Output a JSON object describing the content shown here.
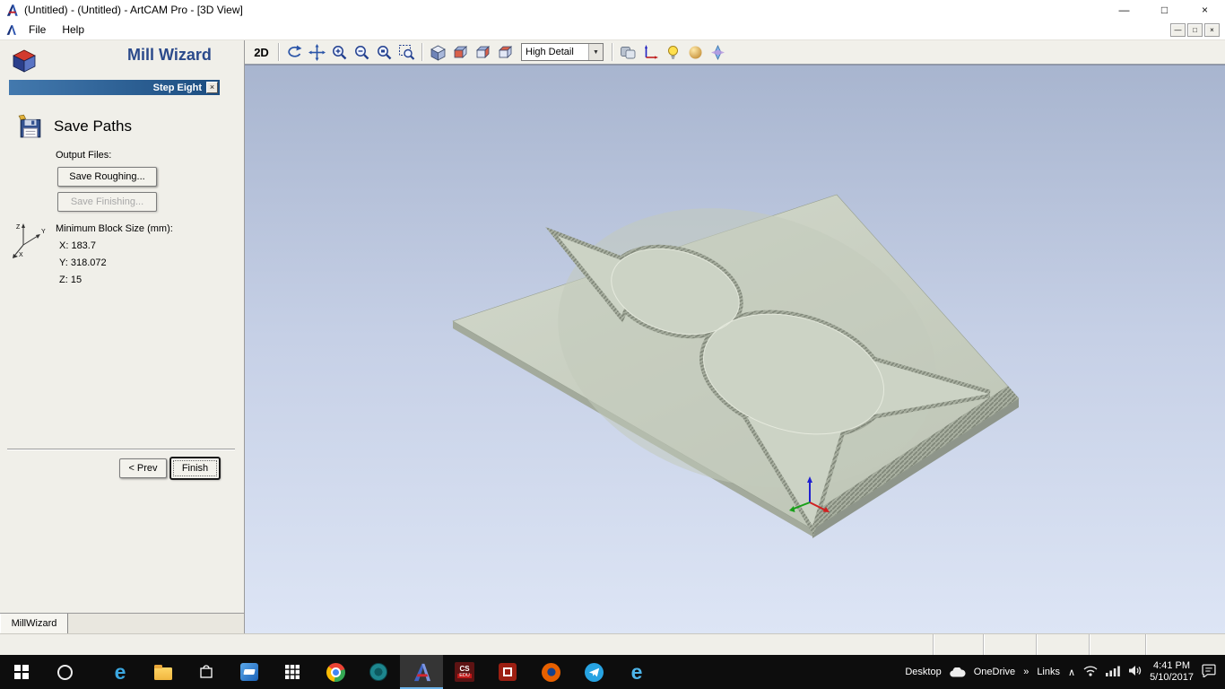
{
  "titlebar": {
    "title": "(Untitled) - (Untitled) - ArtCAM Pro - [3D View]",
    "minimize_glyph": "—",
    "maximize_glyph": "□",
    "close_glyph": "×"
  },
  "menubar": {
    "items": [
      {
        "label": "File"
      },
      {
        "label": "Help"
      }
    ],
    "mdi_minimize_glyph": "—",
    "mdi_restore_glyph": "□",
    "mdi_close_glyph": "×"
  },
  "toolbar": {
    "mode_2d_label": "2D",
    "detail_dropdown_value": "High Detail",
    "dropdown_arrow_glyph": "▼"
  },
  "wizard": {
    "title": "Mill Wizard",
    "step_label": "Step Eight",
    "close_glyph": "×",
    "heading": "Save Paths",
    "output_files_label": "Output Files:",
    "buttons": {
      "save_roughing": "Save Roughing...",
      "save_finishing": "Save Finishing...",
      "prev": "< Prev",
      "finish": "Finish"
    },
    "block_size": {
      "label": "Minimum Block Size (mm):",
      "x": "X: 183.7",
      "y": "Y: 318.072",
      "z": "Z: 15"
    },
    "axes": {
      "x": "X",
      "y": "Y",
      "z": "Z"
    },
    "tab_label": "MillWizard"
  },
  "viewport": {
    "background_top": "#a8b5cf",
    "background_bottom": "#dde5f5",
    "model_surface": "#cbd2c4"
  },
  "taskbar": {
    "desktop_label": "Desktop",
    "onedrive_label": "OneDrive",
    "overflow_glyph": "»",
    "links_label": "Links",
    "hidden_icons_glyph": "∧",
    "edge_glyph": "e",
    "ie_glyph": "e",
    "cs_app_top": "CS",
    "cs_app_bottom": "EDU",
    "time": "4:41 PM",
    "date": "5/10/2017"
  },
  "icons": {
    "toolbar": [
      "rotate-view-icon",
      "pan-view-icon",
      "zoom-in-icon",
      "zoom-out-icon",
      "zoom-object-icon",
      "zoom-fit-icon",
      "isometric-view-icon",
      "view-plane-front-icon",
      "view-plane-side-icon",
      "view-plane-top-icon",
      "grayscale-view-icon",
      "toggle-origin-icon",
      "lighting-icon",
      "material-icon",
      "texture-icon"
    ],
    "taskbar": [
      "start-icon",
      "cortana-icon",
      "edge-icon",
      "file-explorer-icon",
      "store-icon",
      "app-icon-blue",
      "apps-grid-icon",
      "chrome-icon",
      "app-icon-teal",
      "artcam-icon",
      "cs-edu-icon",
      "app-icon-red",
      "firefox-icon",
      "telegram-icon",
      "ie-icon",
      "onedrive-icon",
      "wifi-icon",
      "signal-icon",
      "volume-icon",
      "action-center-icon"
    ]
  }
}
